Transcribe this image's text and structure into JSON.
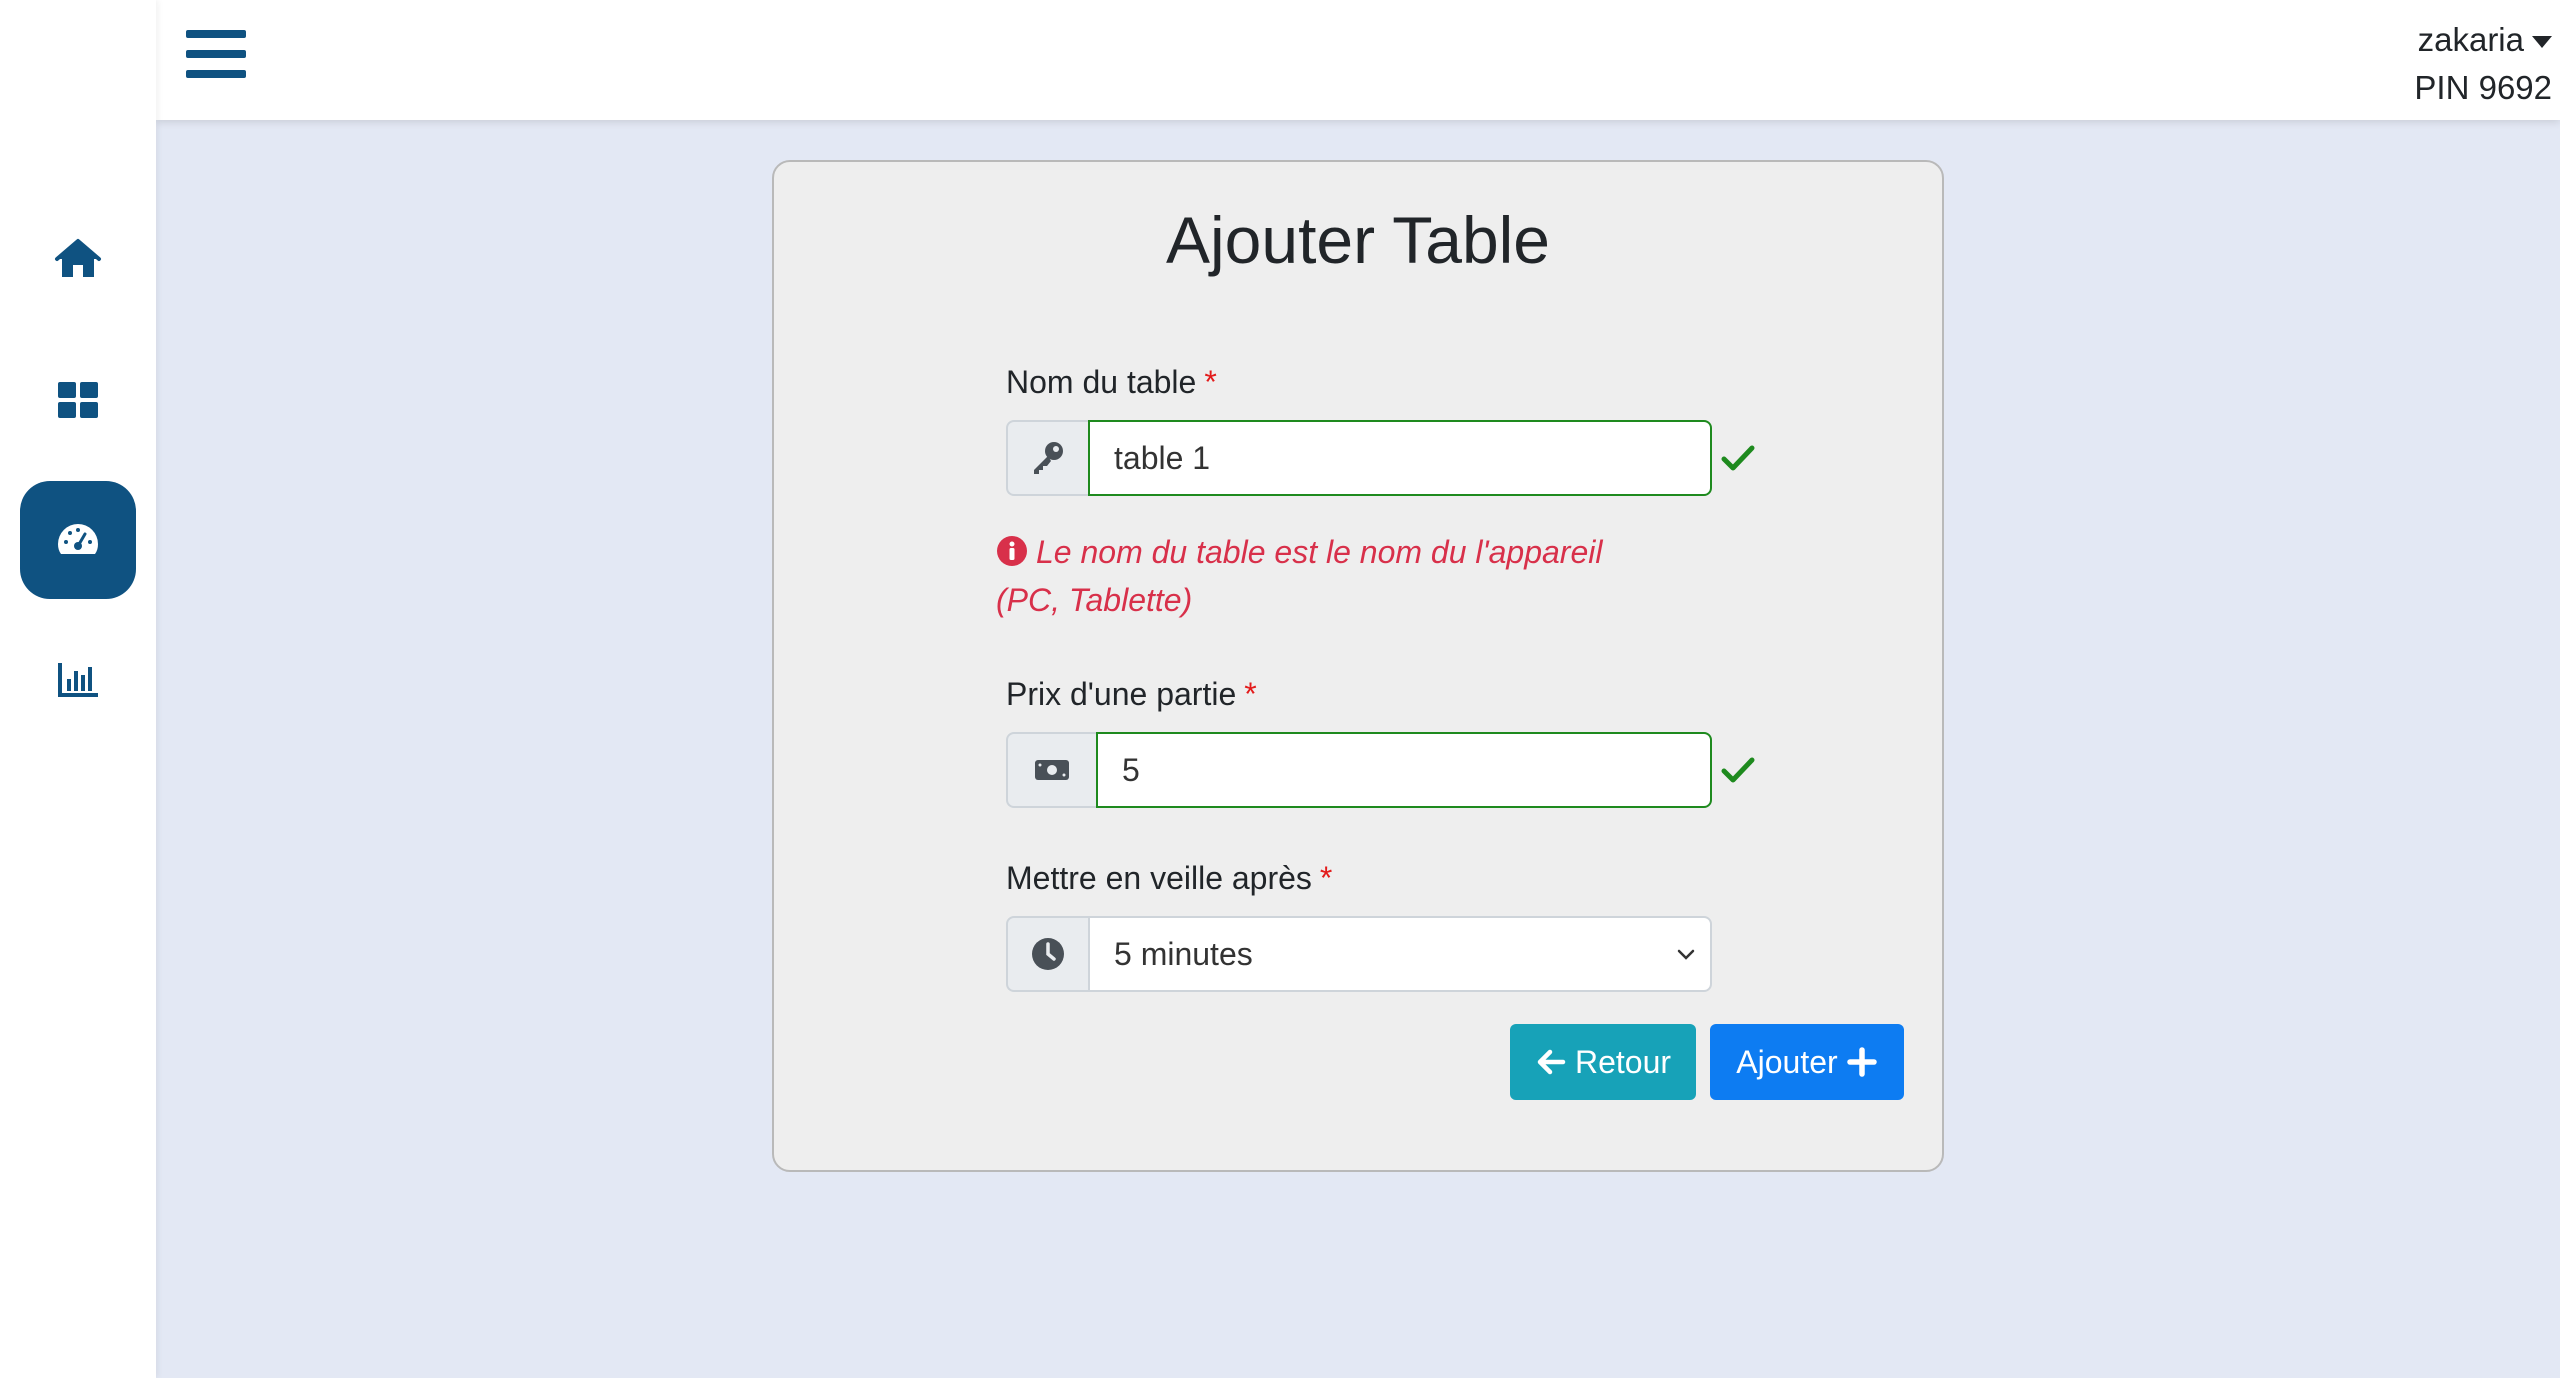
{
  "sidebar": {
    "items": [
      {
        "name": "home",
        "icon": "home-icon",
        "active": false
      },
      {
        "name": "dashboard",
        "icon": "grid-icon",
        "active": false
      },
      {
        "name": "tables",
        "icon": "gauge-icon",
        "active": true
      },
      {
        "name": "stats",
        "icon": "bar-chart-icon",
        "active": false
      }
    ]
  },
  "header": {
    "menu_icon": "hamburger-icon",
    "user": {
      "name": "zakaria",
      "pin": "PIN 9692"
    }
  },
  "form": {
    "title": "Ajouter Table",
    "name_field": {
      "label": "Nom du table",
      "required_mark": "*",
      "value": "table 1",
      "icon": "key-icon",
      "valid": true
    },
    "name_hint": "Le nom du table est le nom du l'appareil (PC, Tablette)",
    "price_field": {
      "label": "Prix d'une partie",
      "required_mark": "*",
      "value": "5",
      "icon": "money-icon",
      "valid": true
    },
    "sleep_field": {
      "label": "Mettre en veille après",
      "required_mark": "*",
      "selected": "5 minutes",
      "icon": "clock-icon"
    },
    "buttons": {
      "back_label": "Retour",
      "add_label": "Ajouter"
    }
  },
  "colors": {
    "primary": "#0f5281",
    "valid": "#1e8a1e",
    "error": "#d8304a",
    "info_button": "#17a2b8",
    "submit_button": "#0d7cf2"
  }
}
